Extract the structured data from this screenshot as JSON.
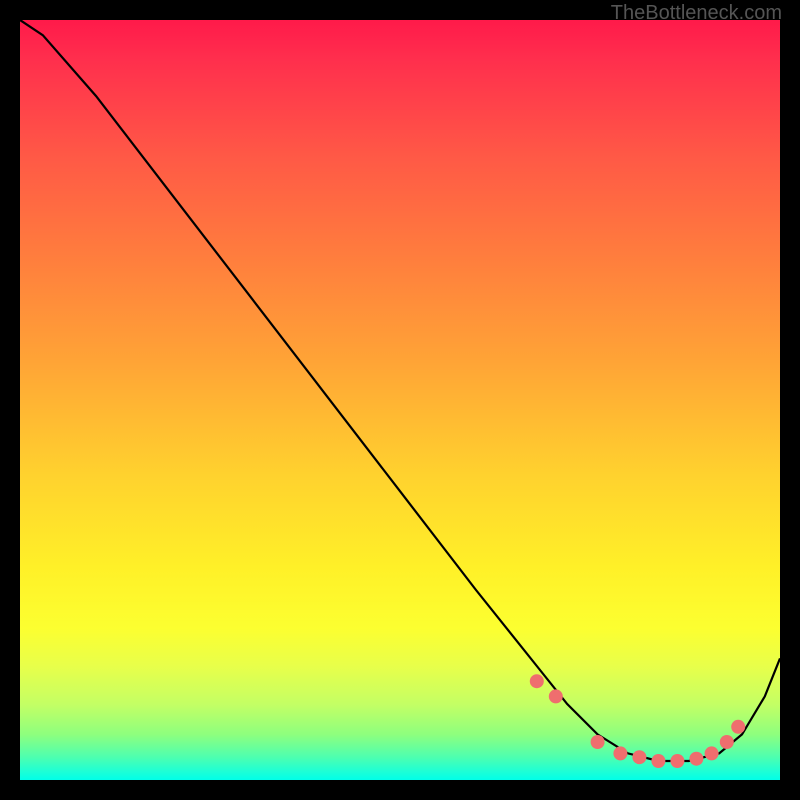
{
  "watermark": "TheBottleneck.com",
  "chart_data": {
    "type": "line",
    "title": "",
    "xlabel": "",
    "ylabel": "",
    "xlim": [
      0,
      100
    ],
    "ylim": [
      0,
      100
    ],
    "grid": false,
    "background": "rainbow-gradient",
    "series": [
      {
        "name": "curve",
        "x": [
          0,
          3,
          10,
          20,
          30,
          40,
          50,
          60,
          68,
          72,
          76,
          80,
          84,
          88,
          92,
          95,
          98,
          100
        ],
        "y": [
          100,
          98,
          90,
          77,
          64,
          51,
          38,
          25,
          15,
          10,
          6,
          3.5,
          2.5,
          2.5,
          3.5,
          6,
          11,
          16
        ]
      }
    ],
    "points": {
      "name": "highlighted-dots",
      "x": [
        68,
        70.5,
        76,
        79,
        81.5,
        84,
        86.5,
        89,
        91,
        93,
        94.5
      ],
      "y": [
        13,
        11,
        5,
        3.5,
        3,
        2.5,
        2.5,
        2.8,
        3.5,
        5,
        7
      ]
    }
  }
}
